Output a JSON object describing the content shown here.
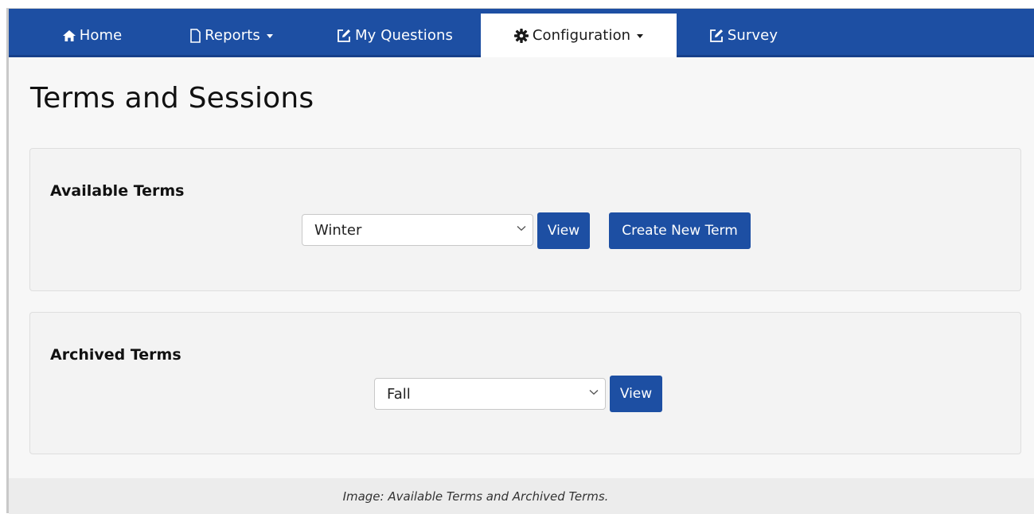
{
  "nav": {
    "items": [
      {
        "label": "Home",
        "icon": "home-icon"
      },
      {
        "label": "Reports",
        "icon": "document-icon",
        "dropdown": true
      },
      {
        "label": "My Questions",
        "icon": "edit-icon"
      },
      {
        "label": "Configuration",
        "icon": "gear-icon",
        "dropdown": true,
        "active": true
      },
      {
        "label": "Survey",
        "icon": "edit-icon"
      }
    ],
    "accent_color": "#1d4fa3"
  },
  "page": {
    "title": "Terms and Sessions"
  },
  "available_terms": {
    "heading": "Available Terms",
    "selected": "Winter",
    "view_label": "View",
    "create_label": "Create New Term"
  },
  "archived_terms": {
    "heading": "Archived Terms",
    "selected": "Fall",
    "view_label": "View"
  },
  "caption": "Image: Available Terms and Archived Terms."
}
